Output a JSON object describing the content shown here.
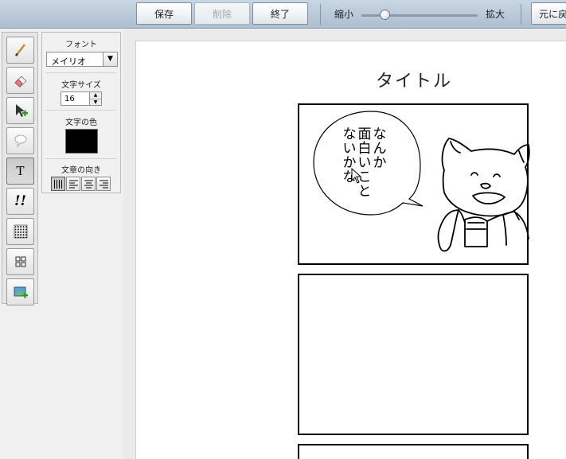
{
  "toolbar": {
    "save_label": "保存",
    "delete_label": "削除",
    "finish_label": "終了",
    "zoom_out_label": "縮小",
    "zoom_in_label": "拡大",
    "zoom_level": 0.2,
    "undo_label": "元に戻"
  },
  "tools": [
    {
      "name": "pen-icon"
    },
    {
      "name": "eraser-icon"
    },
    {
      "name": "move-add-icon"
    },
    {
      "name": "speech-bubble-icon"
    },
    {
      "name": "text-tool-icon",
      "label": "T",
      "active": true
    },
    {
      "name": "exclamation-icon",
      "label": "!!"
    },
    {
      "name": "screentone-icon"
    },
    {
      "name": "panel-layout-icon"
    },
    {
      "name": "insert-image-icon"
    }
  ],
  "text_panel": {
    "font_label": "フォント",
    "font_value": "メイリオ",
    "size_label": "文字サイズ",
    "size_value": "16",
    "color_label": "文字の色",
    "color_value": "#000000",
    "direction_label": "文章の向き",
    "direction_options": [
      "vertical",
      "align-left",
      "align-center",
      "align-right"
    ]
  },
  "canvas": {
    "title": "タイトル",
    "bubble_text_columns": [
      "なんか",
      "面白いこと",
      "ないかな"
    ]
  }
}
